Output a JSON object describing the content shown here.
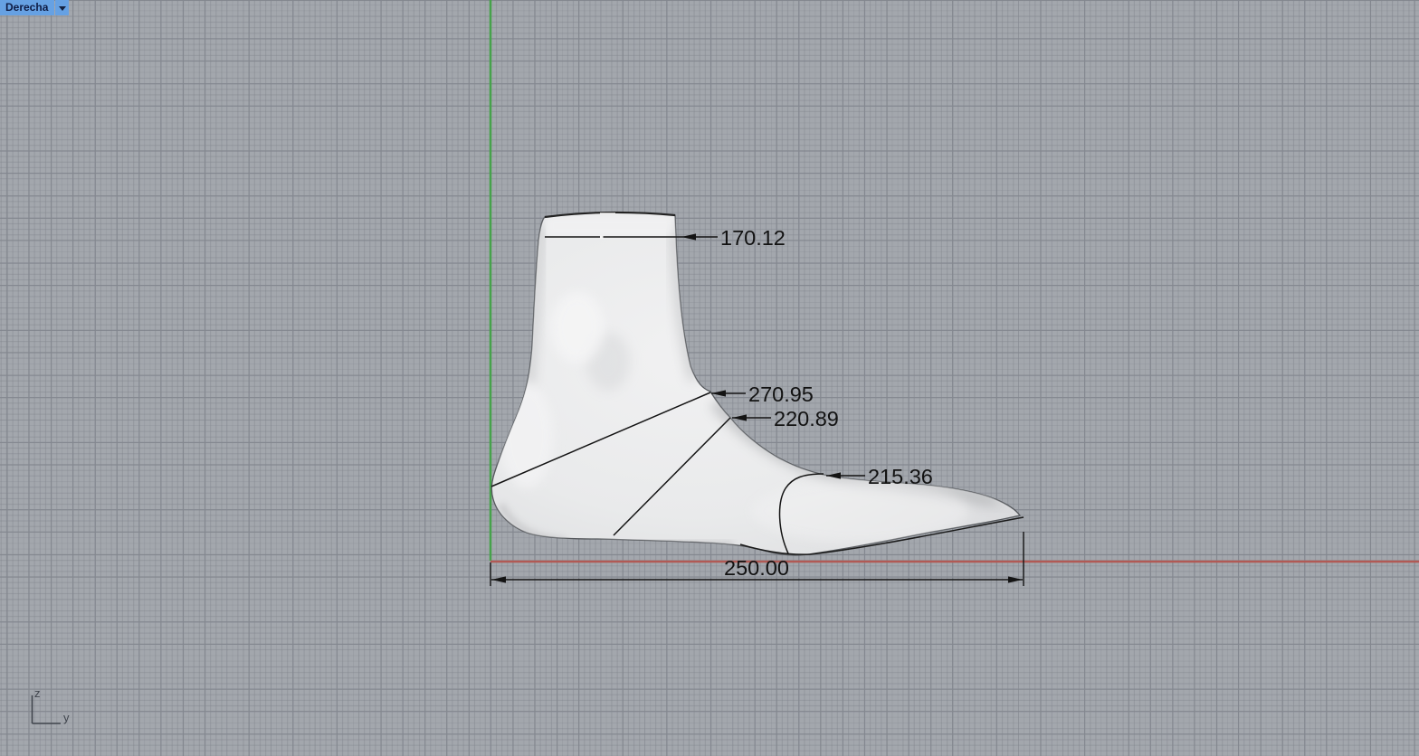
{
  "viewport": {
    "title": "Derecha"
  },
  "dimensions": {
    "ankle_top_width": "170.12",
    "instep_girth": "270.95",
    "waist_girth": "220.89",
    "ball_girth": "215.36",
    "foot_length": "250.00"
  },
  "axis_indicator": {
    "vertical_label": "z",
    "horizontal_label": "y"
  },
  "colors": {
    "background": "#a3a7ad",
    "grid_major": "#83878f",
    "grid_minor": "#969aa2",
    "z_axis_green": "#46a24b",
    "x_axis_red": "#b15a55",
    "viewport_title_bg": "#66a1e3",
    "viewport_title_text": "#0f1c44",
    "model_fill": "#e9eaeb",
    "annotation": "#121212"
  }
}
